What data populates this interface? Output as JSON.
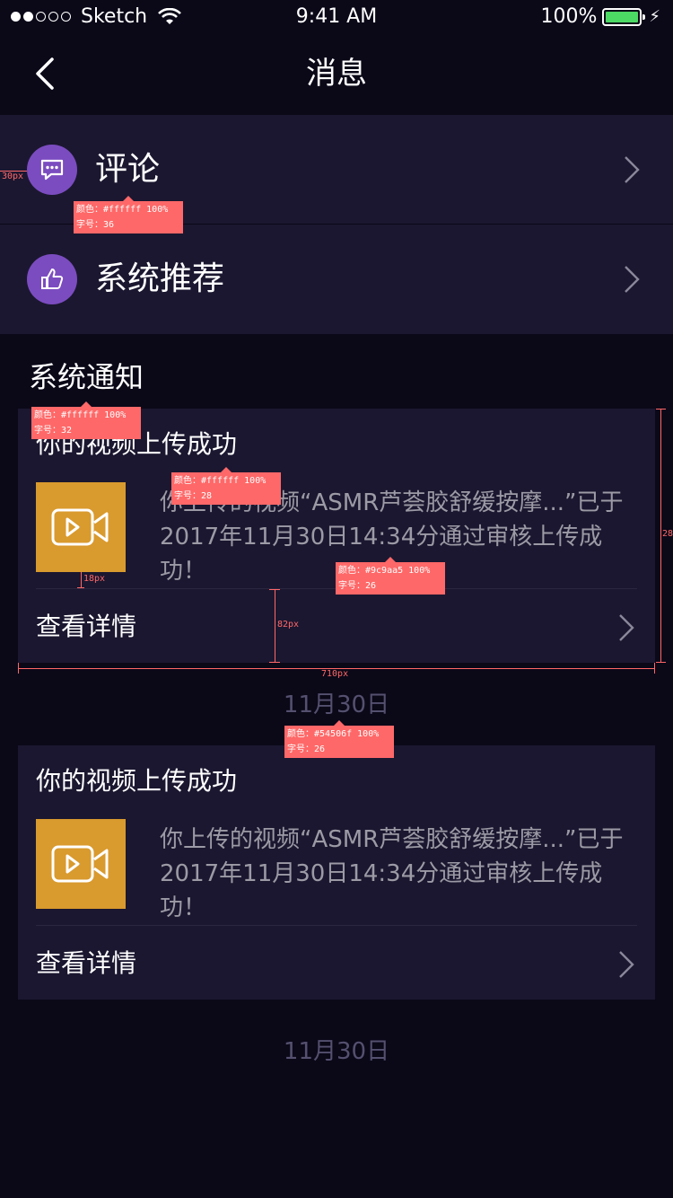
{
  "status_bar": {
    "carrier": "Sketch",
    "time": "9:41 AM",
    "battery_percent": "100%",
    "signal_dots_filled": 2,
    "signal_dots_total": 5
  },
  "nav": {
    "title": "消息"
  },
  "menu": [
    {
      "label": "评论",
      "icon": "comment-icon"
    },
    {
      "label": "系统推荐",
      "icon": "thumbs-up-icon"
    }
  ],
  "section_title": "系统通知",
  "notices": [
    {
      "title": "你的视频上传成功",
      "desc_line1": "你上传的视频“ASMR芦荟胶舒缓按摩...”已于",
      "desc_line2": "2017年11月30日14:34分通过审核上传成功！",
      "detail_label": "查看详情",
      "date": "11月30日"
    },
    {
      "title": "你的视频上传成功",
      "desc_line1": "你上传的视频“ASMR芦荟胶舒缓按摩...”已于",
      "desc_line2": "2017年11月30日14:34分通过审核上传成功！",
      "detail_label": "查看详情",
      "date": "11月30日"
    }
  ],
  "annotations": {
    "a1_line1": "颜色：#ffffff 100%",
    "a1_line2": "字号：36",
    "a2_line1": "颜色：#ffffff 100%",
    "a2_line2": "字号：32",
    "a3_line1": "颜色：#ffffff 100%",
    "a3_line2": "字号：28",
    "a4_line1": "颜色：#9c9aa5 100%",
    "a4_line2": "字号：26",
    "a5_line1": "颜色：#54506f 100%",
    "a5_line2": "字号：26",
    "dim_30": "30px",
    "dim_18": "18px",
    "dim_82": "82px",
    "dim_710": "710px",
    "dim_28": "28"
  },
  "colors": {
    "background": "#0b0818",
    "card": "#1b1730",
    "icon_circle": "#7b4cc0",
    "thumb": "#d99a2e",
    "desc_text": "#9c9aa5",
    "date_text": "#54506f",
    "annotation": "#ff6868"
  }
}
